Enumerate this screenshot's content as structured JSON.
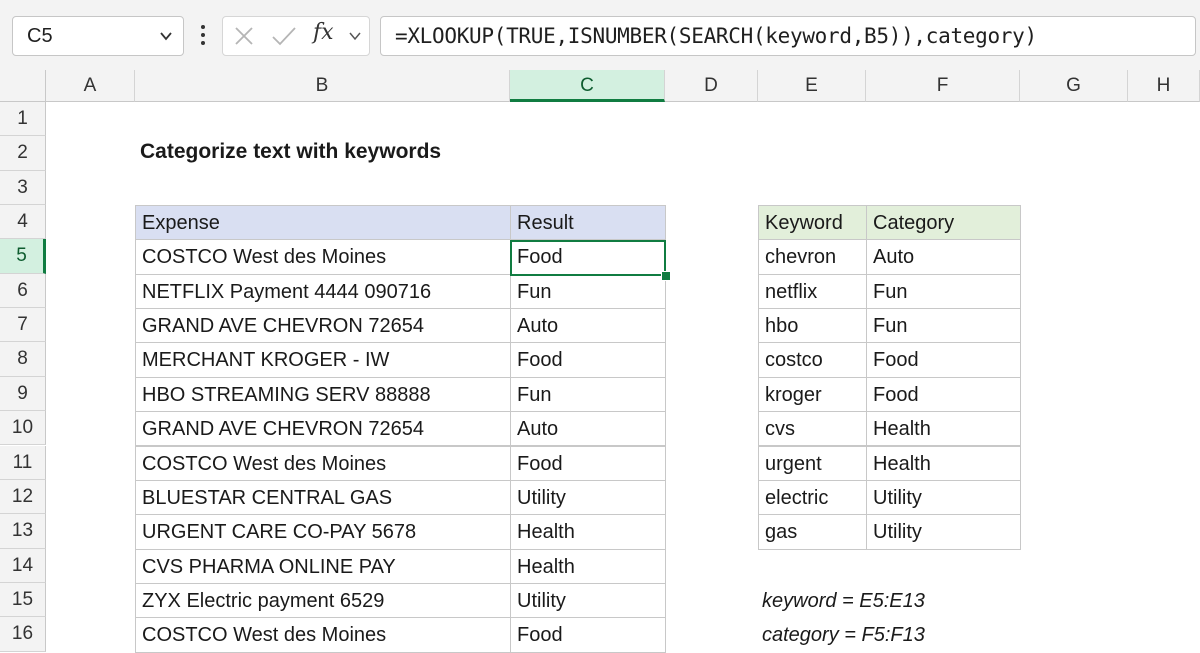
{
  "formula_bar": {
    "name_box": "C5",
    "formula": "=XLOOKUP(TRUE,ISNUMBER(SEARCH(keyword,B5)),category)",
    "fx_label": "fx"
  },
  "columns": [
    "A",
    "B",
    "C",
    "D",
    "E",
    "F",
    "G",
    "H"
  ],
  "active_column": "C",
  "rows": [
    "1",
    "2",
    "3",
    "4",
    "5",
    "6",
    "7",
    "8",
    "9",
    "10",
    "11",
    "12",
    "13",
    "14",
    "15",
    "16"
  ],
  "active_row": "5",
  "title": "Categorize text with keywords",
  "expense_table": {
    "headers": [
      "Expense",
      "Result"
    ],
    "rows": [
      [
        "COSTCO West des Moines",
        "Food"
      ],
      [
        "NETFLIX Payment 4444 090716",
        "Fun"
      ],
      [
        "GRAND AVE CHEVRON 72654",
        "Auto"
      ],
      [
        "MERCHANT KROGER - IW",
        "Food"
      ],
      [
        "HBO STREAMING SERV 88888",
        "Fun"
      ],
      [
        "GRAND AVE CHEVRON 72654",
        "Auto"
      ],
      [
        "COSTCO West des Moines",
        "Food"
      ],
      [
        "BLUESTAR CENTRAL GAS",
        "Utility"
      ],
      [
        "URGENT CARE CO-PAY 5678",
        "Health"
      ],
      [
        "CVS PHARMA ONLINE PAY",
        "Health"
      ],
      [
        "ZYX Electric payment 6529",
        "Utility"
      ],
      [
        "COSTCO West des Moines",
        "Food"
      ]
    ]
  },
  "keyword_table": {
    "headers": [
      "Keyword",
      "Category"
    ],
    "rows": [
      [
        "chevron",
        "Auto"
      ],
      [
        "netflix",
        "Fun"
      ],
      [
        "hbo",
        "Fun"
      ],
      [
        "costco",
        "Food"
      ],
      [
        "kroger",
        "Food"
      ],
      [
        "cvs",
        "Health"
      ],
      [
        "urgent",
        "Health"
      ],
      [
        "electric",
        "Utility"
      ],
      [
        "gas",
        "Utility"
      ]
    ]
  },
  "named_ranges": [
    "keyword = E5:E13",
    "category = F5:F13"
  ],
  "colors": {
    "expense_header_bg": "#d9dff2",
    "keyword_header_bg": "#e2efda",
    "selection": "#107c41"
  }
}
